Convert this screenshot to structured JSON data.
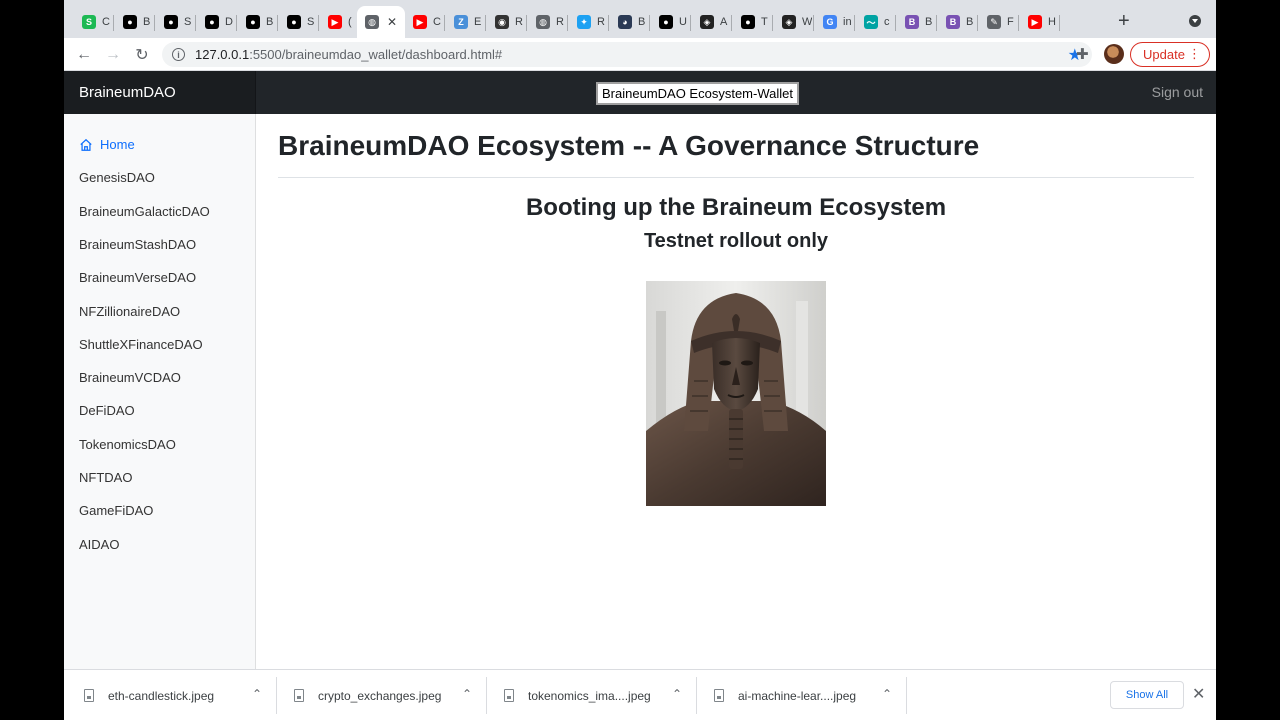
{
  "browser": {
    "tabs": [
      {
        "letter": "C",
        "icon": "green-logo-icon",
        "color": "#1db954"
      },
      {
        "letter": "B",
        "icon": "medium-icon",
        "color": "#000000"
      },
      {
        "letter": "S",
        "icon": "medium-icon",
        "color": "#000000"
      },
      {
        "letter": "D",
        "icon": "medium-icon",
        "color": "#000000"
      },
      {
        "letter": "B",
        "icon": "medium-icon",
        "color": "#000000"
      },
      {
        "letter": "S",
        "icon": "medium-icon",
        "color": "#000000"
      },
      {
        "letter": "(",
        "icon": "youtube-icon",
        "color": "#ff0000"
      },
      {
        "letter": "",
        "icon": "globe-icon",
        "color": "#5f6368",
        "active": true
      },
      {
        "letter": "C",
        "icon": "youtube-icon",
        "color": "#ff0000"
      },
      {
        "letter": "E",
        "icon": "zoom-z-icon",
        "color": "#4a90d9"
      },
      {
        "letter": "R",
        "icon": "android-icon",
        "color": "#333333"
      },
      {
        "letter": "R",
        "icon": "globe-icon",
        "color": "#5f6368"
      },
      {
        "letter": "R",
        "icon": "twitter-icon",
        "color": "#1da1f2"
      },
      {
        "letter": "B",
        "icon": "chart-logo-icon",
        "color": "#2b3a55"
      },
      {
        "letter": "U",
        "icon": "medium-icon",
        "color": "#000000"
      },
      {
        "letter": "A",
        "icon": "replit-icon",
        "color": "#222222"
      },
      {
        "letter": "T",
        "icon": "medium-icon",
        "color": "#000000"
      },
      {
        "letter": "W",
        "icon": "replit-icon",
        "color": "#222222"
      },
      {
        "letter": "in",
        "icon": "google-icon",
        "color": "#4285f4"
      },
      {
        "letter": "c",
        "icon": "wave-icon",
        "color": "#00a3a3"
      },
      {
        "letter": "B",
        "icon": "bootstrap-icon",
        "color": "#7952b3"
      },
      {
        "letter": "B",
        "icon": "bootstrap-icon",
        "color": "#7952b3"
      },
      {
        "letter": "F",
        "icon": "feather-icon",
        "color": "#5f6368"
      },
      {
        "letter": "H",
        "icon": "youtube-icon",
        "color": "#ff0000"
      }
    ],
    "tab_close": "✕",
    "new_tab": "+",
    "url_host": "127.0.0.1",
    "url_path": ":5500/braineumdao_wallet/dashboard.html#",
    "update_label": "Update"
  },
  "navbar": {
    "brand": "BraineumDAO",
    "wallet_label": "BraineumDAO Ecosystem-Wallet",
    "signout": "Sign out"
  },
  "sidebar": {
    "items": [
      {
        "label": "Home",
        "active": true
      },
      {
        "label": "GenesisDAO"
      },
      {
        "label": "BraineumGalacticDAO"
      },
      {
        "label": "BraineumStashDAO"
      },
      {
        "label": "BraineumVerseDAO"
      },
      {
        "label": "NFZillionaireDAO"
      },
      {
        "label": "ShuttleXFinanceDAO"
      },
      {
        "label": "BraineumVCDAO"
      },
      {
        "label": "DeFiDAO"
      },
      {
        "label": "TokenomicsDAO"
      },
      {
        "label": "NFTDAO"
      },
      {
        "label": "GameFiDAO"
      },
      {
        "label": "AIDAO"
      }
    ]
  },
  "main": {
    "title": "BraineumDAO Ecosystem -- A Governance Structure",
    "subtitle": "Booting up the Braineum Ecosystem",
    "tagline": "Testnet rollout only"
  },
  "downloads": {
    "items": [
      {
        "name": "eth-candlestick.jpeg"
      },
      {
        "name": "crypto_exchanges.jpeg"
      },
      {
        "name": "tokenomics_ima....jpeg"
      },
      {
        "name": "ai-machine-lear....jpeg"
      }
    ],
    "show_all": "Show All"
  },
  "colors": {
    "accent": "#0d6efd",
    "navbar": "#212529",
    "update": "#d93025"
  }
}
